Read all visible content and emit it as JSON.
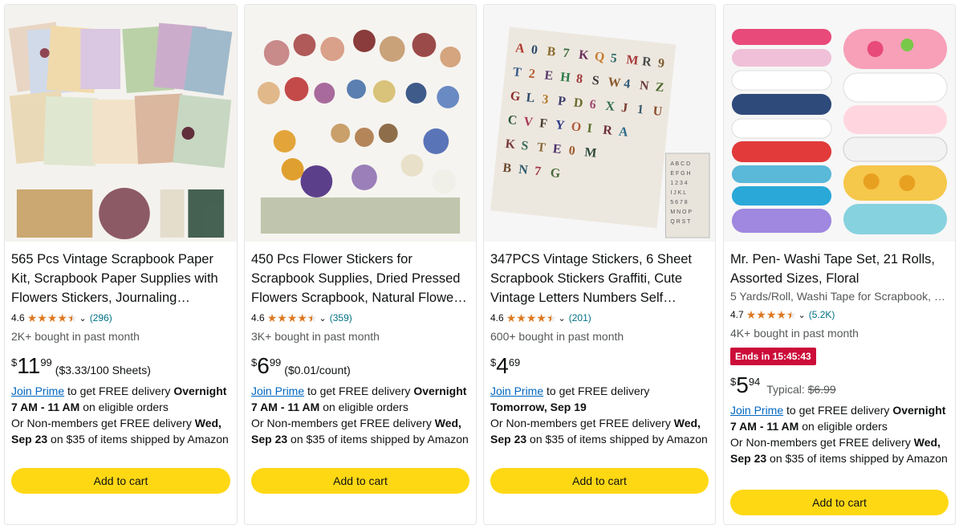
{
  "products": [
    {
      "title": "565 Pcs Vintage Scrapbook Paper Kit, Scrapbook Paper Supplies with Flowers Stickers, Journaling Supplies",
      "rating": "4.6",
      "rating_value": 4.5,
      "reviews": "(296)",
      "bought": "2K+ bought in past month",
      "price_currency": "$",
      "price_whole": "11",
      "price_fraction": "99",
      "unit_price": "($3.33/100 Sheets)",
      "prime_link": "Join Prime",
      "delivery_1": " to get FREE delivery ",
      "delivery_1_bold": "Overnight 7 AM - 11 AM",
      "delivery_1_end": " on eligible orders",
      "delivery_2": "Or Non-members get FREE delivery ",
      "delivery_2_bold": "Wed, Sep 23",
      "delivery_2_end": " on $35 of items shipped by Amazon",
      "add_to_cart": "Add to cart",
      "image_icon": "scrapbook-paper-kit-image"
    },
    {
      "title": "450 Pcs Flower Stickers for Scrapbook Supplies, Dried Pressed Flowers Scrapbook, Natural Flower Stickers",
      "rating": "4.6",
      "rating_value": 4.5,
      "reviews": "(359)",
      "bought": "3K+ bought in past month",
      "price_currency": "$",
      "price_whole": "6",
      "price_fraction": "99",
      "unit_price": "($0.01/count)",
      "prime_link": "Join Prime",
      "delivery_1": " to get FREE delivery ",
      "delivery_1_bold": "Overnight 7 AM - 11 AM",
      "delivery_1_end": " on eligible orders",
      "delivery_2": "Or Non-members get FREE delivery ",
      "delivery_2_bold": "Wed, Sep 23",
      "delivery_2_end": " on $35 of items shipped by Amazon",
      "add_to_cart": "Add to cart",
      "image_icon": "flower-stickers-image"
    },
    {
      "title": "347PCS Vintage Stickers, 6 Sheet Scrapbook Stickers Graffiti, Cute Vintage Letters Numbers Self Adhesive",
      "rating": "4.6",
      "rating_value": 4.5,
      "reviews": "(201)",
      "bought": "600+ bought in past month",
      "price_currency": "$",
      "price_whole": "4",
      "price_fraction": "69",
      "prime_link": "Join Prime",
      "delivery_1": " to get FREE delivery ",
      "delivery_1_bold": "Tomorrow, Sep 19",
      "delivery_2": "Or Non-members get FREE delivery ",
      "delivery_2_bold": "Wed, Sep 23",
      "delivery_2_end": " on $35 of items shipped by Amazon",
      "add_to_cart": "Add to cart",
      "image_icon": "letter-stickers-image"
    },
    {
      "title": "Mr. Pen- Washi Tape Set, 21 Rolls, Assorted Sizes, Floral",
      "subtitle": "5 Yards/Roll, Washi Tape for Scrapbook, Journaling",
      "rating": "4.7",
      "rating_value": 4.5,
      "reviews": "(5.2K)",
      "bought": "4K+ bought in past month",
      "deal": "Ends in 15:45:43",
      "price_currency": "$",
      "price_whole": "5",
      "price_fraction": "94",
      "typical_label": "Typical: ",
      "typical_price": "$6.99",
      "prime_link": "Join Prime",
      "delivery_1": " to get FREE delivery ",
      "delivery_1_bold": "Overnight 7 AM - 11 AM",
      "delivery_1_end": " on eligible orders",
      "delivery_2": "Or Non-members get FREE delivery ",
      "delivery_2_bold": "Wed, Sep 23",
      "delivery_2_end": " on $35 of items shipped by Amazon",
      "add_to_cart": "Add to cart",
      "image_icon": "washi-tape-image"
    }
  ],
  "colors": {
    "star": "#de7921",
    "link": "#0066c0",
    "button": "#ffd814",
    "deal": "#cc0c39"
  }
}
